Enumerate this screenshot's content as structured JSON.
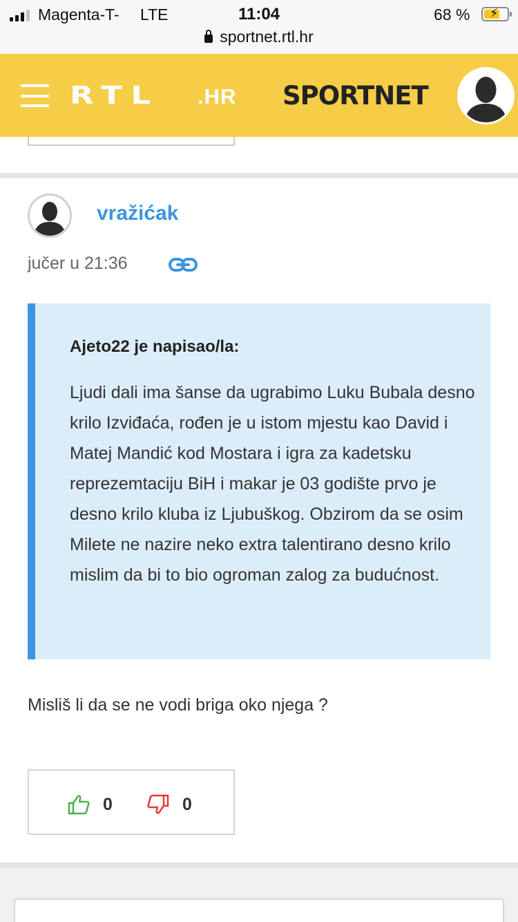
{
  "status_bar": {
    "carrier": "Magenta-T-",
    "network": "LTE",
    "time": "11:04",
    "battery_percent": "68 %",
    "battery_level": 0.68,
    "url": "sportnet.rtl.hr"
  },
  "header": {
    "brand": "RTL",
    "brand_tld": ".HR",
    "section": "SPORTNET",
    "bg_color": "#f6cd47"
  },
  "comment": {
    "username": "vražićak",
    "timestamp": "jučer u 21:36",
    "quote": {
      "author_line": "Ajeto22 je napisao/la:",
      "text": "Ljudi dali ima šanse da ugrabimo Luku Bubala desno krilo Izviđaća, rođen je u istom mjestu kao David i Matej Mandić kod Mostara i igra za kadetsku reprezemtaciju BiH i makar je 03 godište prvo je desno krilo kluba iz Ljubuškog. Obzirom da se osim Milete ne nazire neko extra talentirano desno krilo mislim da bi to bio ogroman zalog za budućnost."
    },
    "reply": "Misliš li da se ne vodi briga oko njega ?",
    "likes": "0",
    "dislikes": "0"
  },
  "colors": {
    "accent": "#3e95e0",
    "quote_bg": "#dcedfa",
    "like": "#4caf50",
    "dislike": "#e53935"
  }
}
